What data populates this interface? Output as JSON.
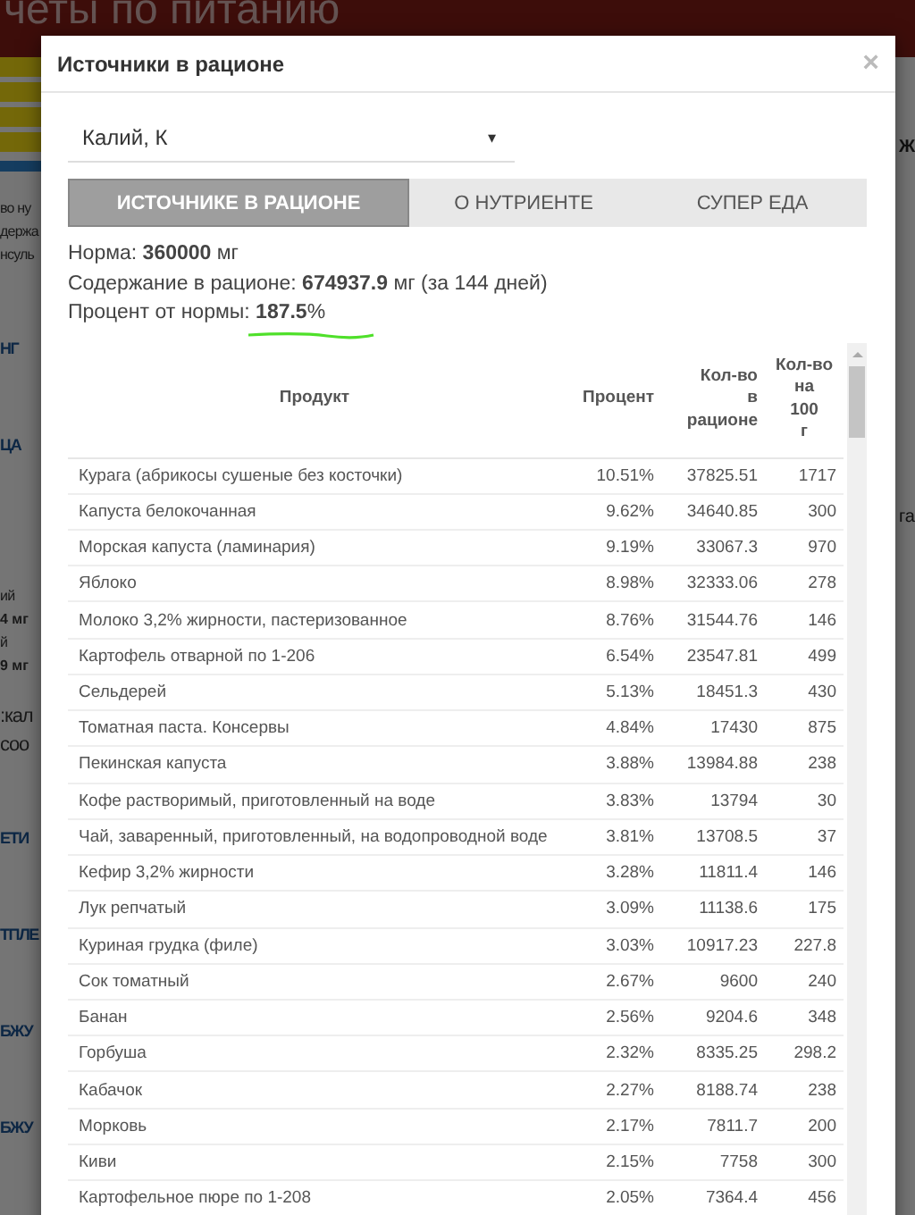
{
  "background": {
    "header_title": "четы по питанию",
    "left_fragments": [
      {
        "kind": "small",
        "text": "во ну"
      },
      {
        "kind": "small",
        "text": "держа"
      },
      {
        "kind": "small",
        "text": "нсуль"
      },
      {
        "kind": "heading",
        "text": "НГ"
      },
      {
        "kind": "heading",
        "text": "ЦА"
      },
      {
        "kind": "small",
        "text": "ий"
      },
      {
        "kind": "smallbold",
        "text": "4 мг"
      },
      {
        "kind": "small",
        "text": "й"
      },
      {
        "kind": "smallbold",
        "text": "9 мг"
      },
      {
        "kind": "large",
        "text": ":кал"
      },
      {
        "kind": "large",
        "text": "соо"
      },
      {
        "kind": "heading",
        "text": "ЕТИ"
      },
      {
        "kind": "heading",
        "text": "ТПЛЕ"
      },
      {
        "kind": "heading",
        "text": "БЖУ"
      },
      {
        "kind": "heading",
        "text": "БЖУ"
      }
    ],
    "right_fragments": [
      {
        "text": "Ж"
      },
      {
        "text": "га"
      }
    ]
  },
  "dialog": {
    "title": "Источники в рационе",
    "close": "×",
    "select": {
      "value": "Калий, К",
      "caret": "▾"
    },
    "tabs": [
      {
        "label": "ИСТОЧНИКЕ В РАЦИОНЕ",
        "selected": true
      },
      {
        "label": "О НУТРИЕНТЕ",
        "selected": false
      },
      {
        "label": "СУПЕР ЕДА",
        "selected": false
      }
    ],
    "info": [
      "Норма: **360000** мг",
      "Содержание в рационе: **674937.9** мг (за 144 дней)",
      "Процент от нормы: **187.5**%"
    ],
    "table": {
      "columns": [
        "Продукт",
        "Процент",
        "Кол-во в рационе",
        "Кол-во на 100 г"
      ],
      "rows": [
        [
          "Курага (абрикосы сушеные без косточки)",
          "10.51%",
          "37825.51",
          "1717"
        ],
        [
          "Капуста белокочанная",
          "9.62%",
          "34640.85",
          "300"
        ],
        [
          "Морская капуста (ламинария)",
          "9.19%",
          "33067.3",
          "970"
        ],
        [
          "Яблоко",
          "8.98%",
          "32333.06",
          "278"
        ],
        [
          "Молоко 3,2% жирности, пастеризованное",
          "8.76%",
          "31544.76",
          "146"
        ],
        [
          "Картофель отварной по 1-206",
          "6.54%",
          "23547.81",
          "499"
        ],
        [
          "Сельдерей",
          "5.13%",
          "18451.3",
          "430"
        ],
        [
          "Томатная паста. Консервы",
          "4.84%",
          "17430",
          "875"
        ],
        [
          "Пекинская капуста",
          "3.88%",
          "13984.88",
          "238"
        ],
        [
          "Кофе растворимый, приготовленный на воде",
          "3.83%",
          "13794",
          "30"
        ],
        [
          "Чай, заваренный, приготовленный, на водопроводной воде",
          "3.81%",
          "13708.5",
          "37"
        ],
        [
          "Кефир 3,2% жирности",
          "3.28%",
          "11811.4",
          "146"
        ],
        [
          "Лук репчатый",
          "3.09%",
          "11138.6",
          "175"
        ],
        [
          "Куриная грудка (филе)",
          "3.03%",
          "10917.23",
          "227.8"
        ],
        [
          "Сок томатный",
          "2.67%",
          "9600",
          "240"
        ],
        [
          "Банан",
          "2.56%",
          "9204.6",
          "348"
        ],
        [
          "Горбуша",
          "2.32%",
          "8335.25",
          "298.2"
        ],
        [
          "Кабачок",
          "2.27%",
          "8188.74",
          "238"
        ],
        [
          "Морковь",
          "2.17%",
          "7811.7",
          "200"
        ],
        [
          "Киви",
          "2.15%",
          "7758",
          "300"
        ],
        [
          "Картофельное пюре по 1-208",
          "2.05%",
          "7364.4",
          "456"
        ]
      ]
    }
  }
}
